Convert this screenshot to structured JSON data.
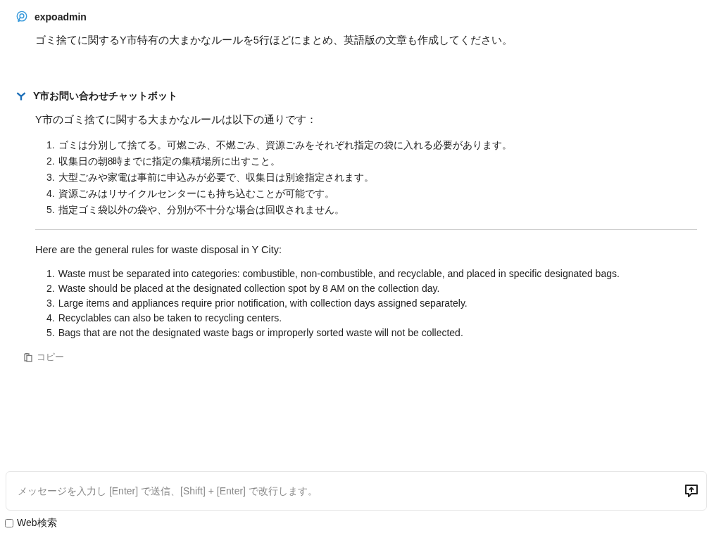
{
  "messages": [
    {
      "kind": "user",
      "author": "expoadmin",
      "text": "ゴミ捨てに関するY市特有の大まかなルールを5行ほどにまとめ、英語版の文章も作成してください。"
    },
    {
      "kind": "bot",
      "author": "Y市お問い合わせチャットボット",
      "sections": [
        {
          "intro": "Y市のゴミ捨てに関する大まかなルールは以下の通りです：",
          "items": [
            {
              "number": "1.",
              "text": "ゴミは分別して捨てる。可燃ごみ、不燃ごみ、資源ごみをそれぞれ指定の袋に入れる必要があります。"
            },
            {
              "number": "2.",
              "text": "収集日の朝8時までに指定の集積場所に出すこと。"
            },
            {
              "number": "3.",
              "text": "大型ごみや家電は事前に申込みが必要で、収集日は別途指定されます。"
            },
            {
              "number": "4.",
              "text": "資源ごみはリサイクルセンターにも持ち込むことが可能です。"
            },
            {
              "number": "5.",
              "text": "指定ゴミ袋以外の袋や、分別が不十分な場合は回収されません。"
            }
          ]
        },
        {
          "intro": "Here are the general rules for waste disposal in Y City:",
          "items": [
            {
              "number": "1.",
              "text": "Waste must be separated into categories: combustible, non-combustible, and recyclable, and placed in specific designated bags."
            },
            {
              "number": "2.",
              "text": "Waste should be placed at the designated collection spot by 8 AM on the collection day."
            },
            {
              "number": "3.",
              "text": "Large items and appliances require prior notification, with collection days assigned separately."
            },
            {
              "number": "4.",
              "text": "Recyclables can also be taken to recycling centers."
            },
            {
              "number": "5.",
              "text": "Bags that are not the designated waste bags or improperly sorted waste will not be collected."
            }
          ]
        }
      ],
      "copy_label": "コピー"
    }
  ],
  "input": {
    "placeholder": "メッセージを入力し [Enter] で送信、[Shift] + [Enter] で改行します。"
  },
  "web_search": {
    "label": "Web検索",
    "checked": false
  }
}
